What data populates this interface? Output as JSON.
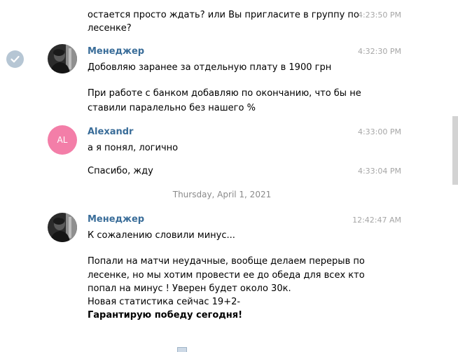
{
  "messages": [
    {
      "lines": [
        "остается просто ждать? или Вы пригласите в группу по",
        "лесенке?"
      ],
      "time": "4:23:50 PM"
    },
    {
      "sender": "Менеджер",
      "time": "4:32:30 PM",
      "lines": [
        "Добовляю заранее за отдельную плату в 1900 грн",
        "",
        "При работе с банком добавляю по окончанию, что бы не",
        "ставили паралельно без нашего %"
      ]
    },
    {
      "sender": "Alexandr",
      "avatar_initials": "AL",
      "avatar_color": "#f37ea8",
      "time": "4:33:00 PM",
      "lines": [
        "а я понял, логично"
      ]
    },
    {
      "time": "4:33:04 PM",
      "lines": [
        "Спасибо, жду"
      ]
    },
    {
      "sender": "Менеджер",
      "time": "12:42:47 AM",
      "lines": [
        "К сожалению словили минус...",
        "",
        "Попали на матчи неудачные, вообще делаем перерыв по",
        "лесенке, но мы хотим провести ее до обеда для всех кто",
        "попал на минус ! Уверен будет около 30к.",
        "Новая статистика сейчас 19+2-",
        "Гарантирую победу сегодня!"
      ]
    }
  ],
  "date_separator": "Thursday, April 1, 2021",
  "icons": {
    "read_check": "check-circle-icon",
    "bottom": "attachment-icon"
  },
  "colors": {
    "sender_name": "#3a6d99",
    "timestamp": "#a6a6a6",
    "check_badge": "#b6c6d4"
  }
}
